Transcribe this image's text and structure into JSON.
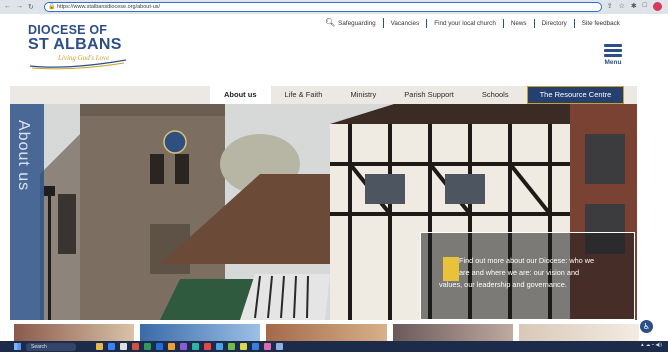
{
  "browser": {
    "url": "https://www.stalbansdiocese.org/about-us/",
    "nav_icons": [
      "back-icon",
      "forward-icon",
      "reload-icon"
    ]
  },
  "logo": {
    "line1": "DIOCESE OF",
    "line2": "ST ALBANS",
    "tagline": "Living God's Love"
  },
  "topnav": {
    "items": [
      "Safeguarding",
      "Vacancies",
      "Find your local church",
      "News",
      "Directory",
      "Site feedback"
    ]
  },
  "menu": {
    "label": "Menu"
  },
  "mainnav": {
    "tabs": [
      "About us",
      "Life & Faith",
      "Ministry",
      "Parish Support",
      "Schools",
      "The Resource Centre"
    ],
    "active": "About us"
  },
  "hero": {
    "side_label": "About us",
    "info_line1": "Find out more about our Diocese: who we",
    "info_line2": "are and where we are: our vision and",
    "info_line3": "values, our leadership and governance."
  },
  "taskbar": {
    "search": "Search"
  },
  "colors": {
    "brand_blue": "#2b4f86",
    "accent_gold": "#c9a227",
    "resource_bg": "#243f70"
  }
}
